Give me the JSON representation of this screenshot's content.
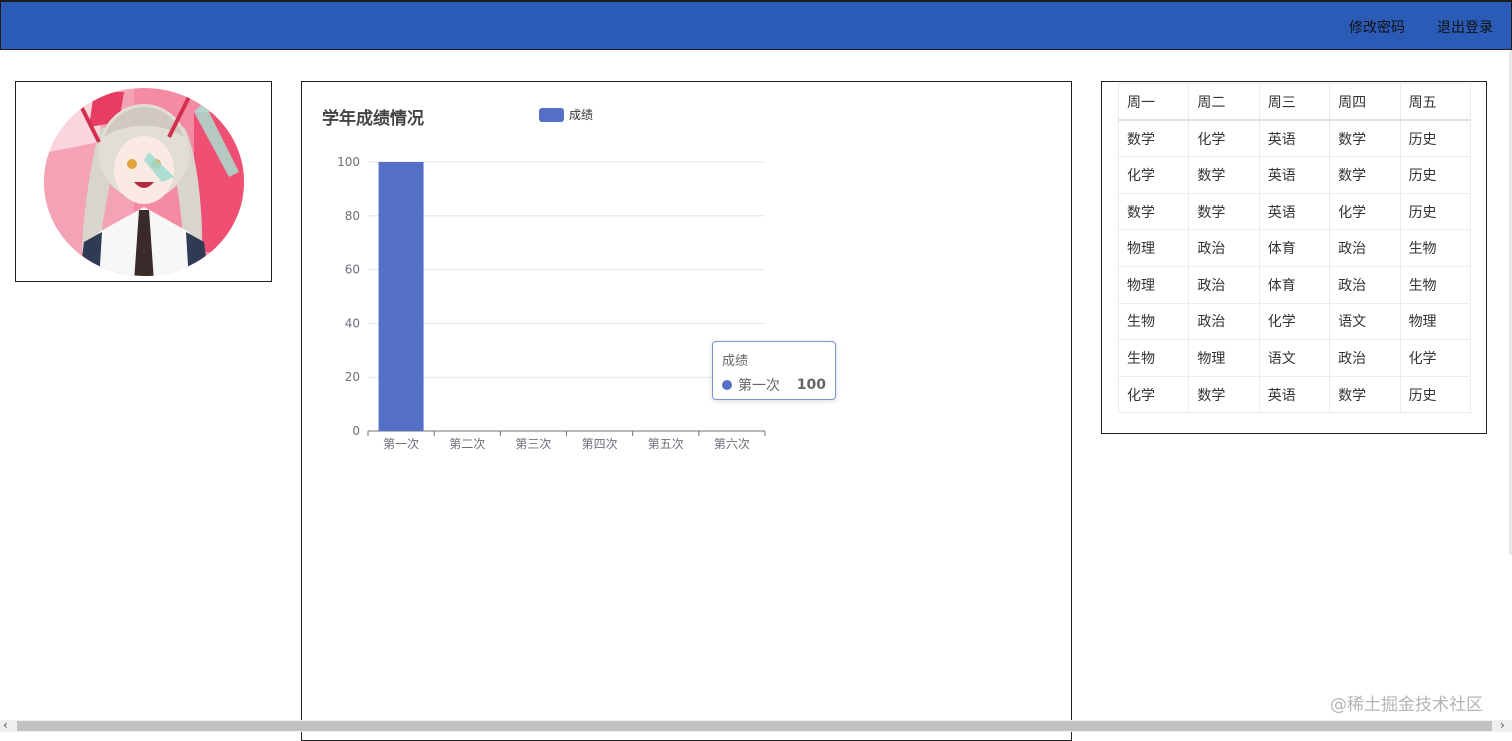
{
  "header": {
    "change_password": "修改密码",
    "logout": "退出登录"
  },
  "avatar": {
    "description_icon": "avatar-image",
    "bg_color": "#f58aa4"
  },
  "chart_data": {
    "type": "bar",
    "title": "学年成绩情况",
    "categories": [
      "第一次",
      "第二次",
      "第三次",
      "第四次",
      "第五次",
      "第六次"
    ],
    "series": [
      {
        "name": "成绩",
        "values": [
          100,
          0,
          0,
          0,
          0,
          0
        ],
        "color": "#5470c6"
      }
    ],
    "ylim": [
      0,
      100
    ],
    "yticks": [
      0,
      20,
      40,
      60,
      80,
      100
    ],
    "grid": true,
    "legend": "top-center",
    "tooltip": {
      "series": "成绩",
      "category": "第一次",
      "value": "100"
    }
  },
  "timetable": {
    "headers": [
      "周一",
      "周二",
      "周三",
      "周四",
      "周五"
    ],
    "rows": [
      [
        "数学",
        "化学",
        "英语",
        "数学",
        "历史"
      ],
      [
        "化学",
        "数学",
        "英语",
        "数学",
        "历史"
      ],
      [
        "数学",
        "数学",
        "英语",
        "化学",
        "历史"
      ],
      [
        "物理",
        "政治",
        "体育",
        "政治",
        "生物"
      ],
      [
        "物理",
        "政治",
        "体育",
        "政治",
        "生物"
      ],
      [
        "生物",
        "政治",
        "化学",
        "语文",
        "物理"
      ],
      [
        "生物",
        "物理",
        "语文",
        "政治",
        "化学"
      ],
      [
        "化学",
        "数学",
        "英语",
        "数学",
        "历史"
      ]
    ]
  },
  "watermark": "@稀土掘金技术社区"
}
